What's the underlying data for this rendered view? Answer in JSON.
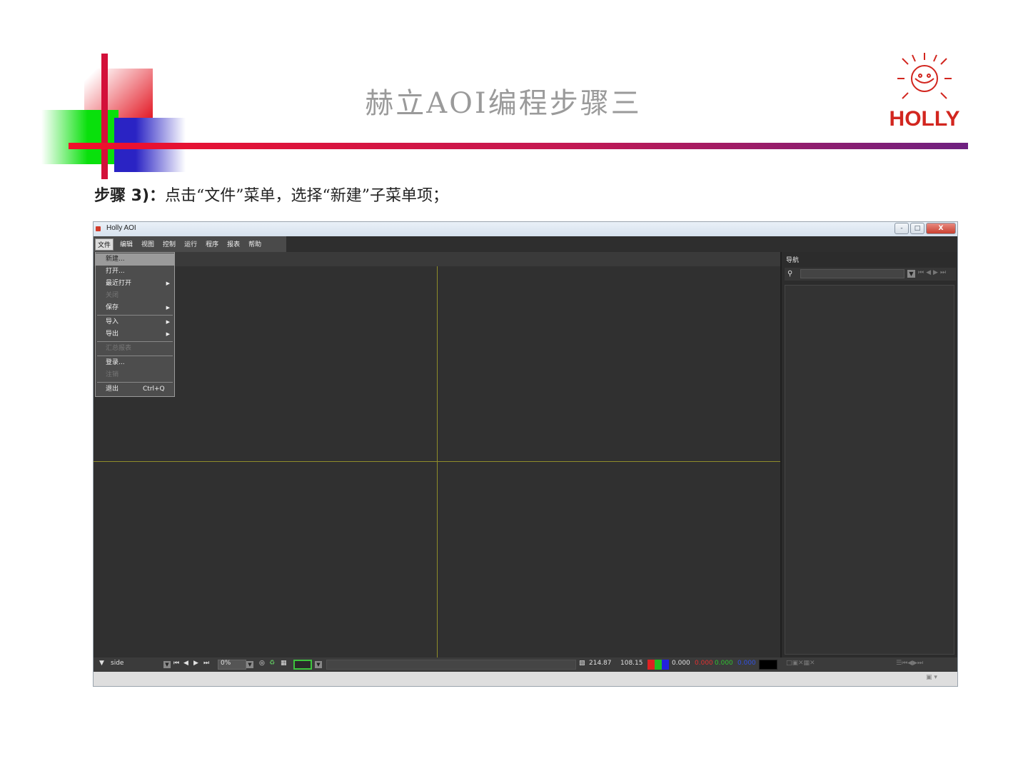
{
  "slide": {
    "title": "赫立AOI编程步骤三",
    "logo_text": "HOLLY",
    "step_prefix": "步骤 3)：",
    "step_text": "点击“文件”菜单，选择“新建”子菜单项；"
  },
  "window": {
    "title": "Holly AOI",
    "minimize": "-",
    "maximize": "□",
    "close": "X"
  },
  "menubar": {
    "items": [
      "文件",
      "编辑",
      "视图",
      "控制",
      "运行",
      "程序",
      "报表",
      "帮助"
    ]
  },
  "file_menu": {
    "items": [
      {
        "label": "新建...",
        "state": "highlighted"
      },
      {
        "label": "打开..."
      },
      {
        "label": "最近打开",
        "submenu": true
      },
      {
        "label": "关闭",
        "state": "disabled"
      },
      {
        "label": "保存",
        "submenu": true
      },
      {
        "label": "导入",
        "submenu": true
      },
      {
        "label": "导出",
        "submenu": true
      },
      {
        "label": "汇总报表",
        "state": "disabled"
      },
      {
        "label": "登录..."
      },
      {
        "label": "注销",
        "state": "disabled"
      },
      {
        "label": "退出",
        "shortcut": "Ctrl+Q"
      }
    ]
  },
  "nav_panel": {
    "title": "导航",
    "search_placeholder": ""
  },
  "statusbar": {
    "side": "side",
    "zoom": "0%",
    "coord_x": "214.87",
    "coord_y": "108.15",
    "val_1": "0.000",
    "val_2": "0.000",
    "val_3": "0.000",
    "val_4": "0.000"
  },
  "colors": {
    "accent_red": "#e8102a",
    "crosshair": "#8f8d2a",
    "logo_red": "#d2261f"
  }
}
